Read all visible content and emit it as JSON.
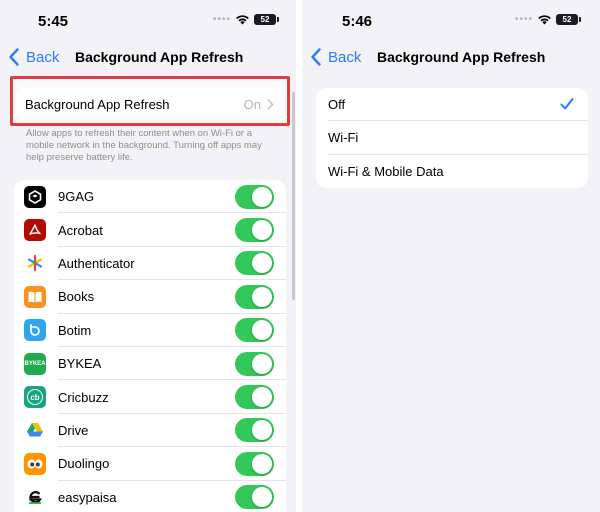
{
  "left": {
    "status": {
      "time": "5:45",
      "battery": "52"
    },
    "nav": {
      "back": "Back",
      "title": "Background App Refresh"
    },
    "main_row": {
      "label": "Background App Refresh",
      "value": "On"
    },
    "footnote": "Allow apps to refresh their content when on Wi-Fi or a mobile network in the background. Turning off apps may help preserve battery life.",
    "apps": [
      {
        "name": "9GAG",
        "icon": "9gag-icon",
        "enabled": true
      },
      {
        "name": "Acrobat",
        "icon": "acrobat-icon",
        "enabled": true
      },
      {
        "name": "Authenticator",
        "icon": "authenticator-icon",
        "enabled": true
      },
      {
        "name": "Books",
        "icon": "books-icon",
        "enabled": true
      },
      {
        "name": "Botim",
        "icon": "botim-icon",
        "enabled": true
      },
      {
        "name": "BYKEA",
        "icon": "bykea-icon",
        "icon_text": "BYKEA",
        "enabled": true
      },
      {
        "name": "Cricbuzz",
        "icon": "cricbuzz-icon",
        "icon_text": "cb",
        "enabled": true
      },
      {
        "name": "Drive",
        "icon": "drive-icon",
        "enabled": true
      },
      {
        "name": "Duolingo",
        "icon": "duolingo-icon",
        "enabled": true
      },
      {
        "name": "easypaisa",
        "icon": "easypaisa-icon",
        "enabled": true
      }
    ]
  },
  "right": {
    "status": {
      "time": "5:46",
      "battery": "52"
    },
    "nav": {
      "back": "Back",
      "title": "Background App Refresh"
    },
    "options": [
      {
        "label": "Off",
        "selected": true
      },
      {
        "label": "Wi-Fi",
        "selected": false
      },
      {
        "label": "Wi-Fi & Mobile Data",
        "selected": false
      }
    ]
  },
  "colors": {
    "accent": "#2f7cf6",
    "toggle_on": "#34c759",
    "highlight": "#e03c3c",
    "background": "#f2f2f7"
  }
}
